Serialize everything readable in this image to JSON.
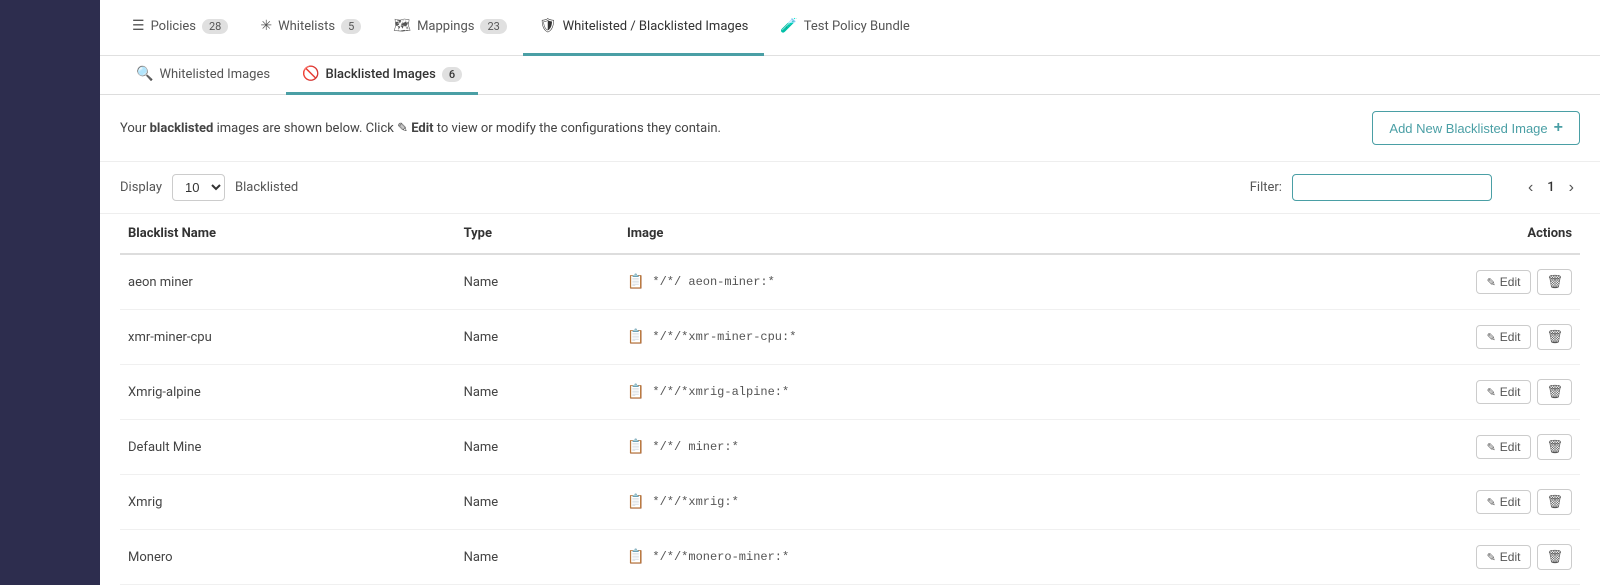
{
  "sidebar": {},
  "topNav": {
    "tabs": [
      {
        "id": "policies",
        "label": "Policies",
        "badge": "28",
        "icon": "☰",
        "active": false
      },
      {
        "id": "whitelists",
        "label": "Whitelists",
        "badge": "5",
        "icon": "✳",
        "active": false
      },
      {
        "id": "mappings",
        "label": "Mappings",
        "badge": "23",
        "icon": "📋",
        "active": false
      },
      {
        "id": "whitelisted-blacklisted",
        "label": "Whitelisted / Blacklisted Images",
        "badge": "",
        "icon": "🛡",
        "active": true
      },
      {
        "id": "test-policy",
        "label": "Test Policy Bundle",
        "badge": "",
        "icon": "🧪",
        "active": false
      }
    ]
  },
  "subTabs": {
    "tabs": [
      {
        "id": "whitelisted",
        "label": "Whitelisted Images",
        "badge": "",
        "icon": "🔍",
        "active": false
      },
      {
        "id": "blacklisted",
        "label": "Blacklisted Images",
        "badge": "6",
        "icon": "🚫",
        "active": true
      }
    ]
  },
  "toolbar": {
    "description_prefix": "Your ",
    "description_bold": "blacklisted",
    "description_suffix": " images are shown below. Click ",
    "edit_word": "Edit",
    "description_end": " to view or modify the configurations they contain.",
    "add_button_label": "Add New Blacklisted Image",
    "add_icon": "+"
  },
  "filterRow": {
    "display_label": "Display",
    "display_value": "10",
    "blacklisted_label": "Blacklisted",
    "filter_label": "Filter:",
    "filter_placeholder": "",
    "page_current": "1",
    "page_prev": "‹",
    "page_next": "›"
  },
  "table": {
    "columns": [
      {
        "id": "name",
        "label": "Blacklist Name"
      },
      {
        "id": "type",
        "label": "Type"
      },
      {
        "id": "image",
        "label": "Image"
      },
      {
        "id": "actions",
        "label": "Actions"
      }
    ],
    "rows": [
      {
        "name": "aeon miner",
        "type": "Name",
        "image": "*/*  /aeon-miner:*"
      },
      {
        "name": "xmr-miner-cpu",
        "type": "Name",
        "image": "*/*/*xmr-miner-cpu:*"
      },
      {
        "name": "Xmrig-alpine",
        "type": "Name",
        "image": "*/*/*xmrig-alpine:*"
      },
      {
        "name": "Default Mine",
        "type": "Name",
        "image": "*/*/*miner:*"
      },
      {
        "name": "Xmrig",
        "type": "Name",
        "image": "*/*/*xmrig:*"
      },
      {
        "name": "Monero",
        "type": "Name",
        "image": "*/*/*monero-miner:*"
      }
    ],
    "imageValues": [
      "*/*/ aeon-miner:*",
      "*/*/*xmr-miner-cpu:*",
      "*/*/*xmrig-alpine:*",
      "*/*/ miner:*",
      "*/*/*xmrig:*",
      "*/*/*monero-miner:*"
    ],
    "edit_label": "Edit",
    "delete_icon": "🗑"
  }
}
